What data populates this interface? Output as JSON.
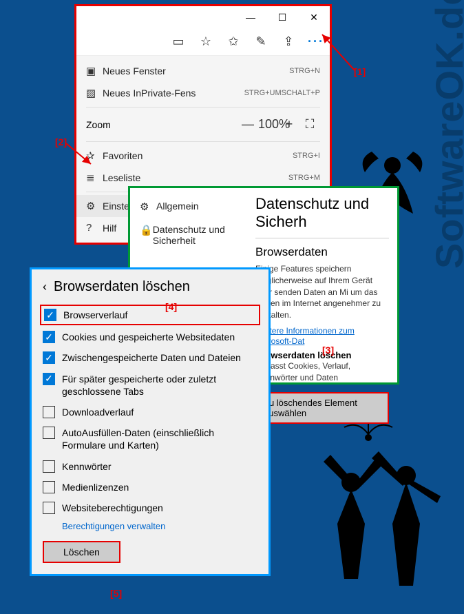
{
  "watermark": "SoftwareOK.de",
  "window": {
    "min": "—",
    "max": "☐",
    "close": "✕"
  },
  "menu": {
    "new_window": "Neues Fenster",
    "new_window_key": "STRG+N",
    "new_inprivate": "Neues InPrivate-Fens",
    "new_inprivate_key": "STRG+UMSCHALT+P",
    "zoom": "Zoom",
    "zoom_out": "—",
    "zoom_val": "100%",
    "zoom_in": "+",
    "zoom_full": "⛶",
    "favorites": "Favoriten",
    "favorites_key": "STRG+I",
    "readlist": "Leseliste",
    "readlist_key": "STRG+M",
    "settings": "Einstellungen",
    "help": "Hilf"
  },
  "settings_panel": {
    "general": "Allgemein",
    "privacy": "Datenschutz und Sicherheit",
    "title": "Datenschutz und Sicherh",
    "sub": "Browserdaten",
    "desc": "Einige Features speichern möglicherweise auf Ihrem Gerät oder senden Daten an Mi um das Surfen im Internet angenehmer zu gestalten.",
    "link": "Weitere Informationen zum Microsoft-Dat",
    "clear_title": "Browserdaten löschen",
    "clear_desc": "Umfasst Cookies, Verlauf, Kennwörter und Daten",
    "choose_btn": "Zu löschendes Element auswählen"
  },
  "clear_panel": {
    "title": "Browserdaten löschen",
    "items": [
      {
        "label": "Browserverlauf",
        "checked": true
      },
      {
        "label": "Cookies und gespeicherte Websitedaten",
        "checked": true
      },
      {
        "label": "Zwischengespeicherte Daten und Dateien",
        "checked": true
      },
      {
        "label": "Für später gespeicherte oder zuletzt geschlossene Tabs",
        "checked": true
      },
      {
        "label": "Downloadverlauf",
        "checked": false
      },
      {
        "label": "AutoAusfüllen-Daten (einschließlich Formulare und Karten)",
        "checked": false
      },
      {
        "label": "Kennwörter",
        "checked": false
      },
      {
        "label": "Medienlizenzen",
        "checked": false
      },
      {
        "label": "Websiteberechtigungen",
        "checked": false
      }
    ],
    "manage": "Berechtigungen verwalten",
    "clear_btn": "Löschen"
  },
  "annotations": {
    "a1": "[1]",
    "a2": "[2]",
    "a3": "[3]",
    "a4": "[4]",
    "a5": "[5]"
  }
}
